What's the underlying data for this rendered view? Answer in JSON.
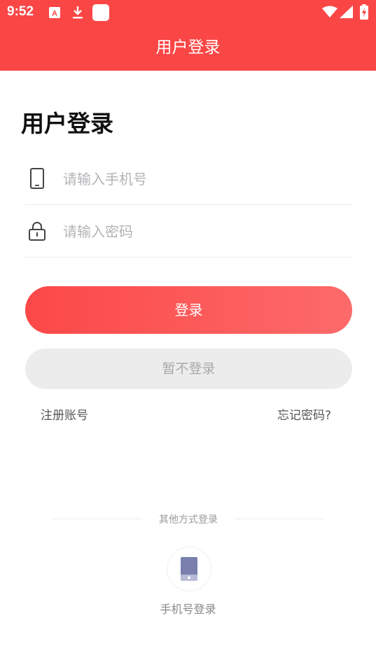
{
  "status_bar": {
    "time": "9:52",
    "icons": [
      "a-badge-icon",
      "download-icon",
      "square-app-icon",
      "wifi-icon",
      "signal-icon",
      "battery-charging-icon"
    ]
  },
  "app_bar": {
    "title": "用户登录"
  },
  "form": {
    "heading": "用户登录",
    "phone_placeholder": "请输入手机号",
    "password_placeholder": "请输入密码",
    "login_label": "登录",
    "skip_label": "暂不登录",
    "register_label": "注册账号",
    "forgot_label": "忘记密码?"
  },
  "other_login": {
    "label": "其他方式登录",
    "phone_login_label": "手机号登录"
  },
  "colors": {
    "primary": "#fb4646",
    "button_gradient_end": "#fd6a6a",
    "skip_bg": "#ececec",
    "phone_icon": "#7b7fae"
  }
}
